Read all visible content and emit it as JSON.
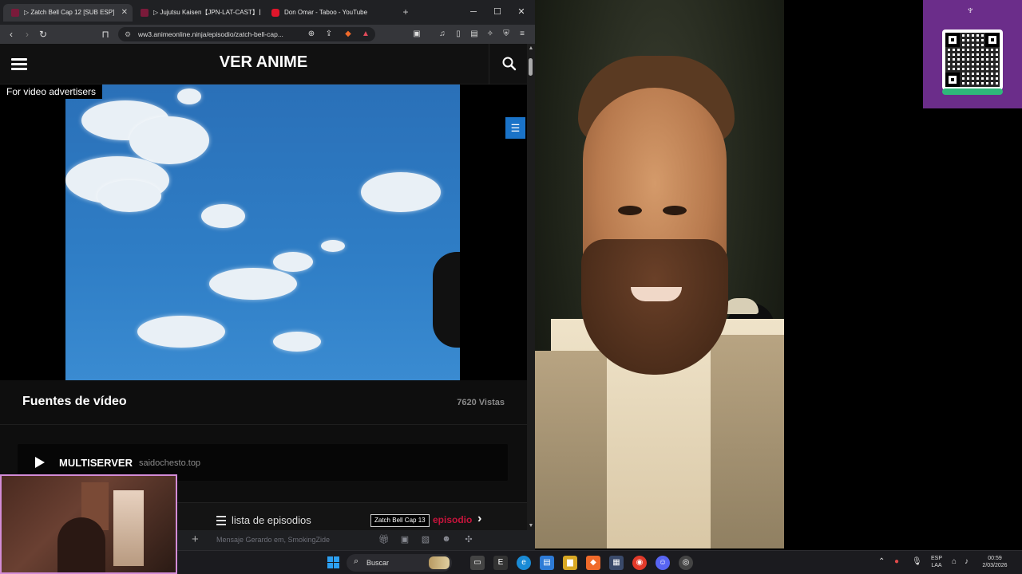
{
  "browser": {
    "tabs": [
      {
        "title": "▷ Zatch Bell Cap 12 [SUB ESP]",
        "active": true
      },
      {
        "title": "▷ Jujutsu Kaisen【JPN-LAT-CAST】【E",
        "active": false
      },
      {
        "title": "Don Omar - Taboo - YouTube",
        "active": false
      }
    ],
    "new_tab": "+",
    "window_controls": {
      "minimize": "─",
      "maximize": "☐",
      "close": "✕"
    },
    "url": "ww3.animeonline.ninja/episodio/zatch-bell-cap..."
  },
  "site": {
    "title": "VER ANIME",
    "ad_label": "For video advertisers",
    "sources_title": "Fuentes de vídeo",
    "views": "7620 Vistas",
    "server": {
      "name": "MULTISERVER",
      "host": "saidochesto.top"
    },
    "episode_list_label": "lista de episodios",
    "next_tooltip": "Zatch Bell Cap 13",
    "next_label": "episodio",
    "next_arrow": "›"
  },
  "chat": {
    "placeholder": "Mensaje Gerardo em, SmokingZide"
  },
  "taskbar": {
    "search_label": "Buscar",
    "tray_lang": "ESP",
    "tray_region": "LAA",
    "time": "00:59",
    "date": "2/03/2026"
  },
  "colors": {
    "accent_red": "#c8143c",
    "menu_blue": "#1a73c8",
    "qr_purple": "#6b2d8a"
  },
  "icons": [
    "search-icon",
    "hamburger-icon",
    "play-icon",
    "list-icon",
    "chevron-right-icon",
    "back-icon",
    "forward-icon",
    "reload-icon",
    "bookmark-icon",
    "windows-start-icon"
  ]
}
